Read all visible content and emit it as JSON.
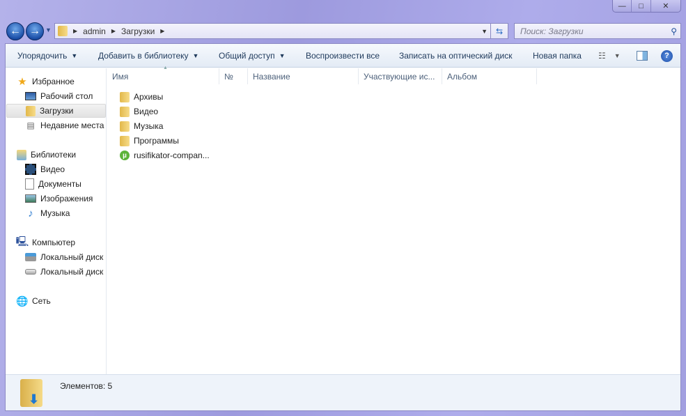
{
  "window": {
    "controls": {
      "minimize": "—",
      "maximize": "□",
      "close": "✕"
    }
  },
  "nav": {
    "back_icon": "arrow-left",
    "forward_icon": "arrow-right"
  },
  "address": {
    "crumbs": [
      "admin",
      "Загрузки"
    ]
  },
  "search": {
    "placeholder": "Поиск: Загрузки"
  },
  "toolbar": {
    "items": [
      "Упорядочить",
      "Добавить в библиотеку",
      "Общий доступ",
      "Воспроизвести все",
      "Записать на оптический диск",
      "Новая папка"
    ]
  },
  "sidebar": {
    "favorites": {
      "label": "Избранное",
      "items": [
        "Рабочий стол",
        "Загрузки",
        "Недавние места"
      ]
    },
    "libraries": {
      "label": "Библиотеки",
      "items": [
        "Видео",
        "Документы",
        "Изображения",
        "Музыка"
      ]
    },
    "computer": {
      "label": "Компьютер",
      "items": [
        "Локальный диск",
        "Локальный диск"
      ]
    },
    "network": {
      "label": "Сеть"
    }
  },
  "columns": [
    "Имя",
    "№",
    "Название",
    "Участвующие ис...",
    "Альбом"
  ],
  "files": [
    {
      "name": "Архивы",
      "type": "folder"
    },
    {
      "name": "Видео",
      "type": "folder"
    },
    {
      "name": "Музыка",
      "type": "folder"
    },
    {
      "name": "Программы",
      "type": "folder"
    },
    {
      "name": "rusifikator-compan...",
      "type": "utorrent"
    }
  ],
  "status": {
    "text": "Элементов: 5"
  }
}
